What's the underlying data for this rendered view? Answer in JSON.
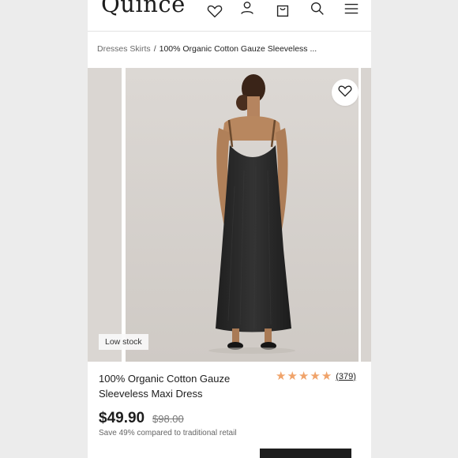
{
  "header": {
    "logo": "Quince",
    "icons": [
      "heart-icon",
      "account-icon",
      "bag-icon",
      "search-icon",
      "menu-icon"
    ]
  },
  "breadcrumb": {
    "category": "Dresses Skirts",
    "separator": "/",
    "current": "100% Organic Cotton Gauze Sleeveless ..."
  },
  "gallery": {
    "stock_badge": "Low stock"
  },
  "product": {
    "title": "100% Organic Cotton Gauze Sleeveless Maxi Dress",
    "rating": 5,
    "review_count": "(379)",
    "price": "$49.90",
    "original_price": "$98.00",
    "savings": "Save 49% compared to traditional retail"
  },
  "colors": {
    "star": "#f0a36a",
    "cta": "#1e1e1e",
    "dress": "#2a2a2a"
  }
}
